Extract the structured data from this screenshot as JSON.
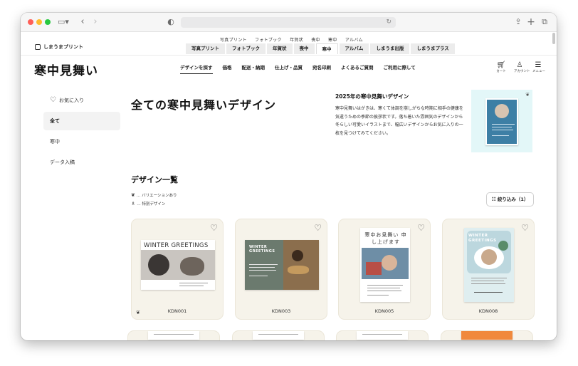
{
  "browser": {
    "address": "",
    "icons": [
      "sidebar-icon",
      "back-icon",
      "forward-icon",
      "shield-icon",
      "reload-icon",
      "share-icon",
      "new-tab-icon",
      "tabs-icon"
    ]
  },
  "site": {
    "brand": "しまうまプリント",
    "ghost_nav": [
      "写真プリント",
      "フォトブック",
      "年賀状",
      "喪中",
      "寒中",
      "アルバム"
    ],
    "service_tabs": [
      "写真プリント",
      "フォトブック",
      "年賀状",
      "喪中",
      "寒中",
      "アルバム",
      "しまうま出版",
      "しまうまプラス"
    ],
    "active_service_tab": "寒中"
  },
  "header": {
    "title": "寒中見舞い",
    "nav": [
      "デザインを探す",
      "価格",
      "配送・納期",
      "仕上げ・品質",
      "宛名印刷",
      "よくあるご質問",
      "ご利用に際して"
    ],
    "icons": [
      {
        "name": "cart-icon",
        "label": "カート"
      },
      {
        "name": "account-icon",
        "label": "アカウント"
      },
      {
        "name": "menu-icon",
        "label": "メニュー"
      }
    ]
  },
  "sidebar": {
    "items": [
      {
        "label": "お気に入り",
        "icon": "heart-icon"
      },
      {
        "label": "全て",
        "active": true
      },
      {
        "label": "寒中"
      },
      {
        "label": "データ入稿"
      }
    ]
  },
  "main": {
    "title": "全ての寒中見舞いデザイン",
    "intro_title": "2025年の寒中見舞いデザイン",
    "intro_text": "寒中見舞いはがきは、寒くて体調を崩しがちな時期に相手の健康を気遣うための季節の挨拶状です。落ち着いた雰囲気のデザインから冬らしい可愛いイラストまで、幅広いデザインからお気に入りの一枚を見つけてみてください。",
    "section_title": "デザイン一覧",
    "legend_variation": "… バリエーションあり",
    "legend_special": "… 特別デザイン",
    "filter_label": "絞り込み（1）"
  },
  "products": [
    {
      "code": "KDN001",
      "heading": "WINTER GREETINGS",
      "variation": true
    },
    {
      "code": "KDN003",
      "heading": "WINTER GREETINGS",
      "variation": false
    },
    {
      "code": "KDN005",
      "heading": "寒中お見舞い 申し上げます",
      "variation": false
    },
    {
      "code": "KDN008",
      "heading": "WINTER GREETINGS",
      "variation": false
    }
  ],
  "colors": {
    "card_bg": "#f6f3ea",
    "feature_bg": "#e3f7f8",
    "feature_card": "#3d7fa5",
    "kdn003_bg": "#6b7a6e",
    "kdn008_bg": "#dfeef0"
  }
}
